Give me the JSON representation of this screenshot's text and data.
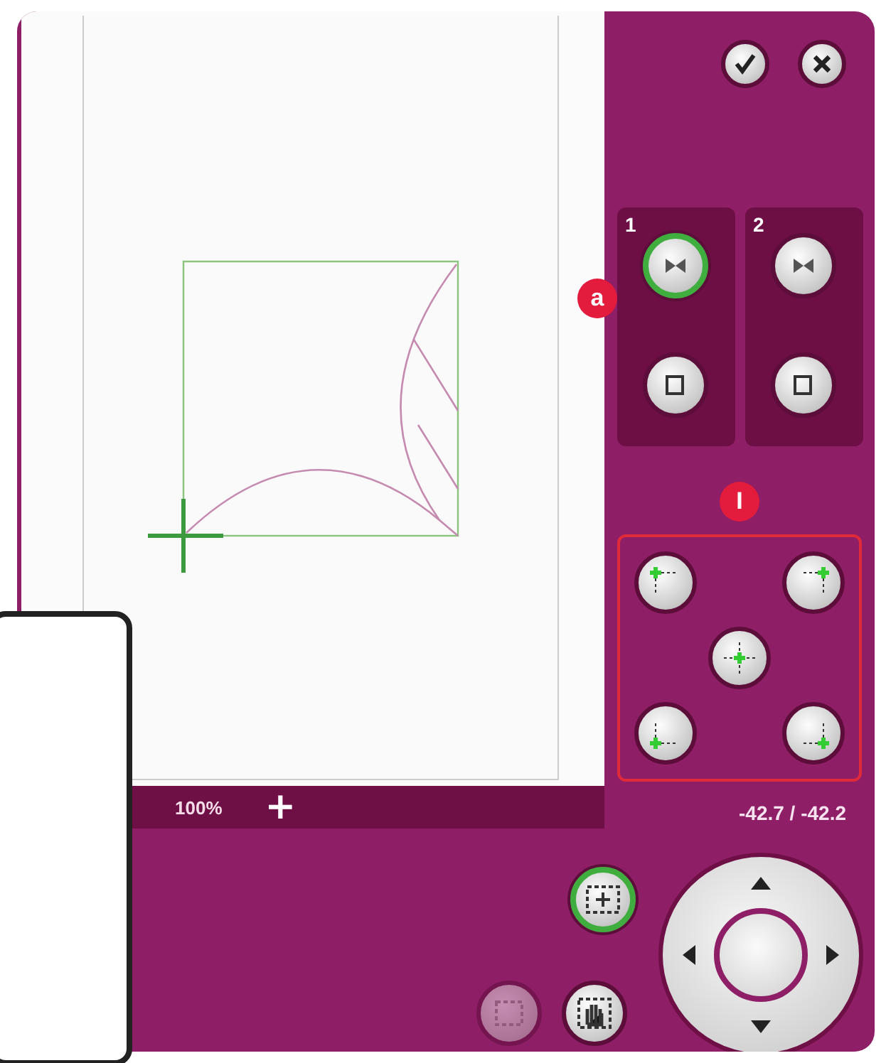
{
  "groups": [
    {
      "label": "1",
      "buttons": [
        {
          "selected": true
        },
        {
          "selected": false
        }
      ]
    },
    {
      "label": "2",
      "buttons": [
        {
          "selected": false
        },
        {
          "selected": false
        }
      ]
    }
  ],
  "zoom_bar": {
    "level": "100%",
    "zoom_in": "+"
  },
  "position_reading": "-42.7 / -42.2",
  "bottom_buttons": [
    {
      "selected": true,
      "disabled": false
    },
    {
      "selected": false,
      "disabled": true
    },
    {
      "selected": false,
      "disabled": false
    }
  ],
  "callouts": [
    {
      "label": "a"
    },
    {
      "label": "I"
    }
  ]
}
